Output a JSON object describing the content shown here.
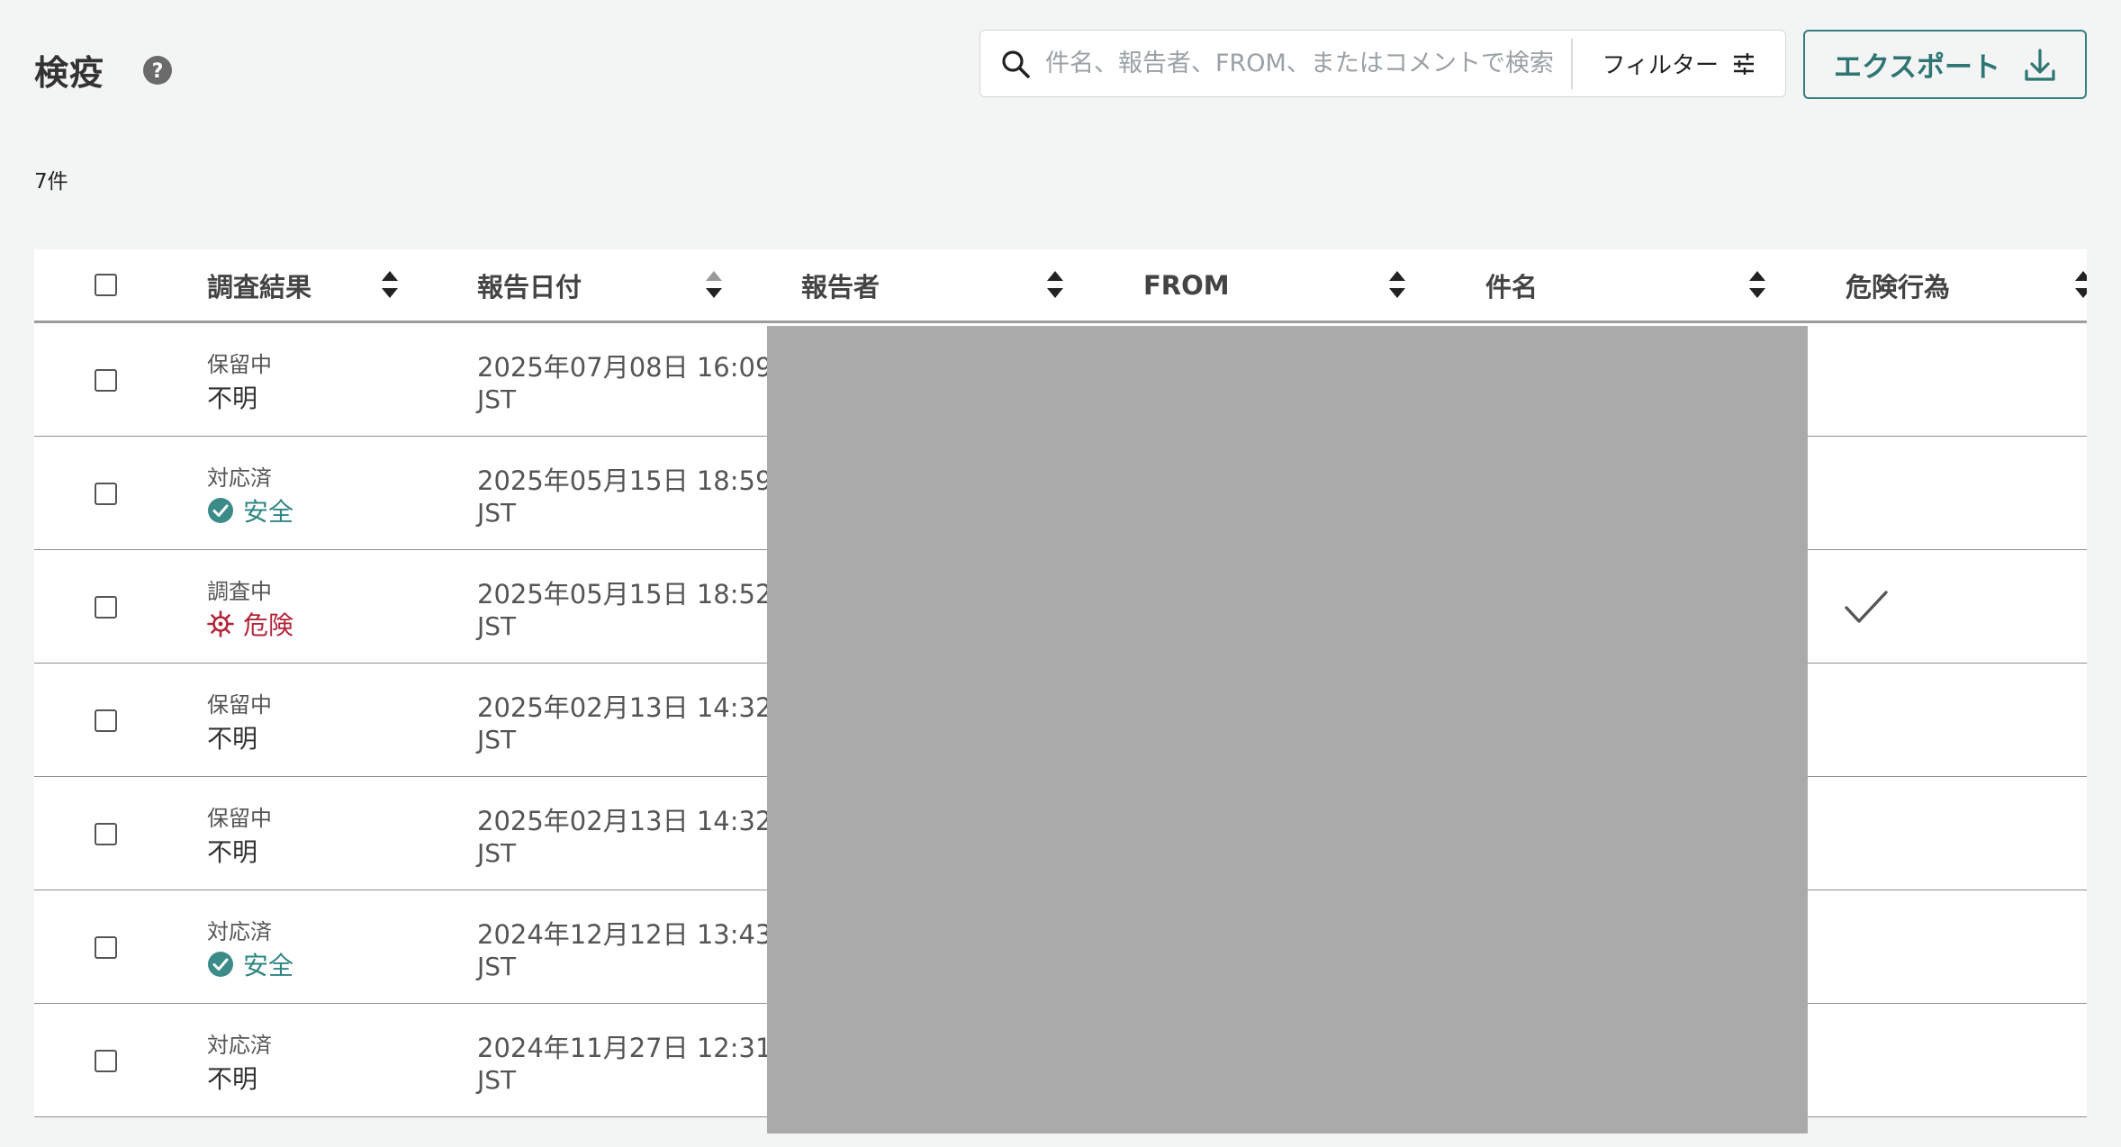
{
  "header": {
    "title": "検疫"
  },
  "search": {
    "placeholder": "件名、報告者、FROM、またはコメントで検索",
    "value": ""
  },
  "filter": {
    "label": "フィルター"
  },
  "export": {
    "label": "エクスポート"
  },
  "count": "7件",
  "columns": [
    {
      "label": "調査結果"
    },
    {
      "label": "報告日付"
    },
    {
      "label": "報告者"
    },
    {
      "label": "FROM"
    },
    {
      "label": "件名"
    },
    {
      "label": "危険行為"
    }
  ],
  "colors": {
    "accent": "#2e7573",
    "safe": "#3b8b88",
    "danger": "#b3253a",
    "redaction": "#aaaaaa"
  },
  "rows": [
    {
      "status": "保留中",
      "result": "不明",
      "result_type": "unknown",
      "date": "2025年07月08日 16:09",
      "tz": "JST",
      "danger_action": false
    },
    {
      "status": "対応済",
      "result": "安全",
      "result_type": "safe",
      "date": "2025年05月15日 18:59",
      "tz": "JST",
      "danger_action": false
    },
    {
      "status": "調査中",
      "result": "危険",
      "result_type": "danger",
      "date": "2025年05月15日 18:52",
      "tz": "JST",
      "danger_action": true
    },
    {
      "status": "保留中",
      "result": "不明",
      "result_type": "unknown",
      "date": "2025年02月13日 14:32",
      "tz": "JST",
      "danger_action": false
    },
    {
      "status": "保留中",
      "result": "不明",
      "result_type": "unknown",
      "date": "2025年02月13日 14:32",
      "tz": "JST",
      "danger_action": false
    },
    {
      "status": "対応済",
      "result": "安全",
      "result_type": "safe",
      "date": "2024年12月12日 13:43",
      "tz": "JST",
      "danger_action": false
    },
    {
      "status": "対応済",
      "result": "不明",
      "result_type": "unknown",
      "date": "2024年11月27日 12:31",
      "tz": "JST",
      "danger_action": false
    }
  ]
}
